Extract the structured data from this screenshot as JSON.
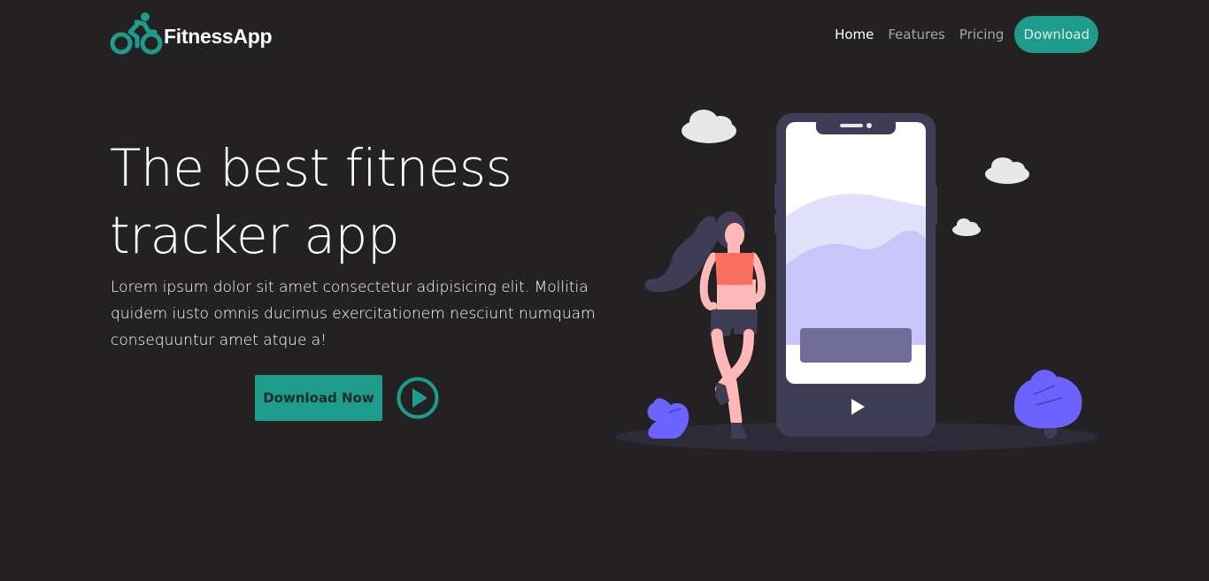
{
  "brand": {
    "name": "FitnessApp",
    "accent_color": "#1d9b8b",
    "logo_icon": "cyclist-icon"
  },
  "nav": {
    "links": [
      {
        "label": "Home",
        "active": true
      },
      {
        "label": "Features",
        "active": false
      },
      {
        "label": "Pricing",
        "active": false
      }
    ],
    "download_label": "Download"
  },
  "hero": {
    "title": "The best fitness tracker app",
    "description": "Lorem ipsum dolor sit amet consectetur adipisicing elit. Mollitia quidem iusto omnis ducimus exercitationem nesciunt numquam consequuntur amet atque a!",
    "cta_label": "Download Now",
    "play_icon": "play-circle-icon"
  },
  "illustration": {
    "subject": "phone-with-runner",
    "colors": {
      "phone": "#3f3d56",
      "screen_wave": "#c9c5f8",
      "bush": "#6c63ff",
      "skin": "#ffb8b8",
      "top": "#f87060"
    }
  },
  "theme": {
    "background": "#232122"
  }
}
